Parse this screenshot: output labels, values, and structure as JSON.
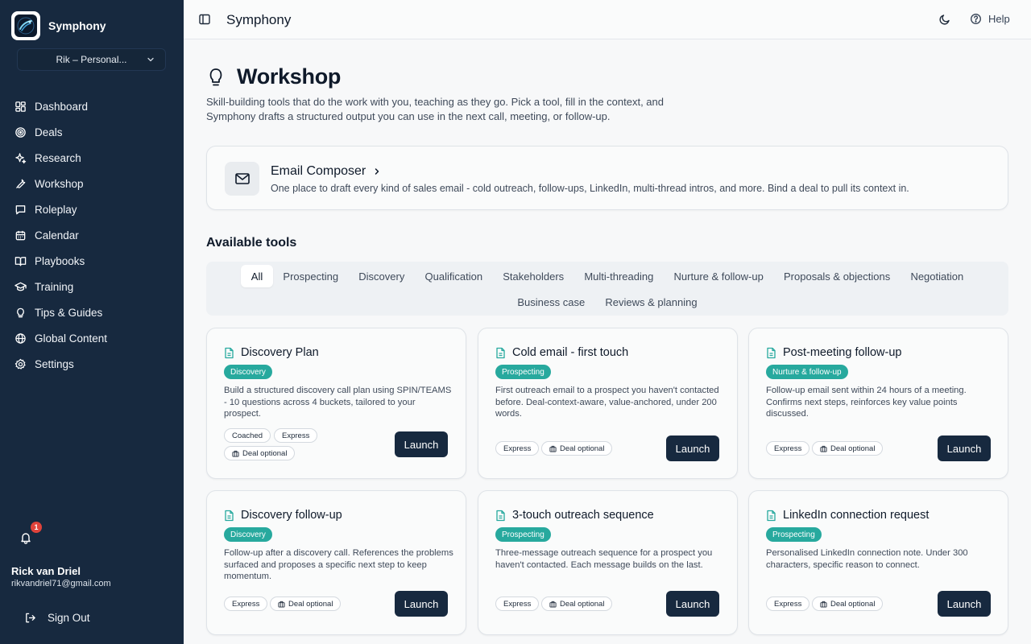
{
  "app": {
    "name": "Symphony",
    "workspace": "Rik – Personal..."
  },
  "sidebar": {
    "items": [
      {
        "label": "Dashboard",
        "icon": "grid-icon"
      },
      {
        "label": "Deals",
        "icon": "target-icon"
      },
      {
        "label": "Research",
        "icon": "sparkle-icon"
      },
      {
        "label": "Workshop",
        "icon": "wrench-icon"
      },
      {
        "label": "Roleplay",
        "icon": "chat-icon"
      },
      {
        "label": "Calendar",
        "icon": "calendar-icon"
      },
      {
        "label": "Playbooks",
        "icon": "book-icon"
      },
      {
        "label": "Training",
        "icon": "graduation-cap-icon"
      },
      {
        "label": "Tips & Guides",
        "icon": "lightbulb-icon"
      },
      {
        "label": "Global Content",
        "icon": "globe-icon"
      },
      {
        "label": "Settings",
        "icon": "gear-icon"
      }
    ],
    "notifications_count": "1",
    "user": {
      "name": "Rick van Driel",
      "email": "rikvandriel71@gmail.com"
    },
    "sign_out": "Sign Out"
  },
  "topbar": {
    "title": "Symphony",
    "help": "Help"
  },
  "page": {
    "title": "Workshop",
    "description": "Skill-building tools that do the work with you, teaching as they go. Pick a tool, fill in the context, and Symphony drafts a structured output you can use in the next call, meeting, or follow-up."
  },
  "composer": {
    "title": "Email Composer",
    "description": "One place to draft every kind of sales email - cold outreach, follow-ups, LinkedIn, multi-thread intros, and more. Bind a deal to pull its context in."
  },
  "tools_section": {
    "title": "Available tools"
  },
  "filters": {
    "row1": [
      "All",
      "Prospecting",
      "Discovery",
      "Qualification",
      "Stakeholders",
      "Multi-threading",
      "Nurture & follow-up",
      "Proposals & objections",
      "Negotiation"
    ],
    "row2": [
      "Business case",
      "Reviews & planning"
    ],
    "active": "All"
  },
  "cards": [
    {
      "title": "Discovery Plan",
      "badge": "Discovery",
      "description": "Build a structured discovery call plan using SPIN/TEAMS - 10 questions across 4 buckets, tailored to your prospect.",
      "tags": [
        "Coached",
        "Express",
        "Deal optional"
      ],
      "action": "Launch"
    },
    {
      "title": "Cold email - first touch",
      "badge": "Prospecting",
      "description": "First outreach email to a prospect you haven't contacted before. Deal-context-aware, value-anchored, under 200 words.",
      "tags": [
        "Express",
        "Deal optional"
      ],
      "action": "Launch"
    },
    {
      "title": "Post-meeting follow-up",
      "badge": "Nurture & follow-up",
      "description": "Follow-up email sent within 24 hours of a meeting. Confirms next steps, reinforces key value points discussed.",
      "tags": [
        "Express",
        "Deal optional"
      ],
      "action": "Launch"
    },
    {
      "title": "Discovery follow-up",
      "badge": "Discovery",
      "description": "Follow-up after a discovery call. References the problems surfaced and proposes a specific next step to keep momentum.",
      "tags": [
        "Express",
        "Deal optional"
      ],
      "action": "Launch"
    },
    {
      "title": "3-touch outreach sequence",
      "badge": "Prospecting",
      "description": "Three-message outreach sequence for a prospect you haven't contacted. Each message builds on the last.",
      "tags": [
        "Express",
        "Deal optional"
      ],
      "action": "Launch"
    },
    {
      "title": "LinkedIn connection request",
      "badge": "Prospecting",
      "description": "Personalised LinkedIn connection note. Under 300 characters, specific reason to connect.",
      "tags": [
        "Express",
        "Deal optional"
      ],
      "action": "Launch"
    }
  ],
  "colors": {
    "sidebar": "#17293f",
    "accent_badge": "#27a99e",
    "notification": "#e0433b"
  }
}
